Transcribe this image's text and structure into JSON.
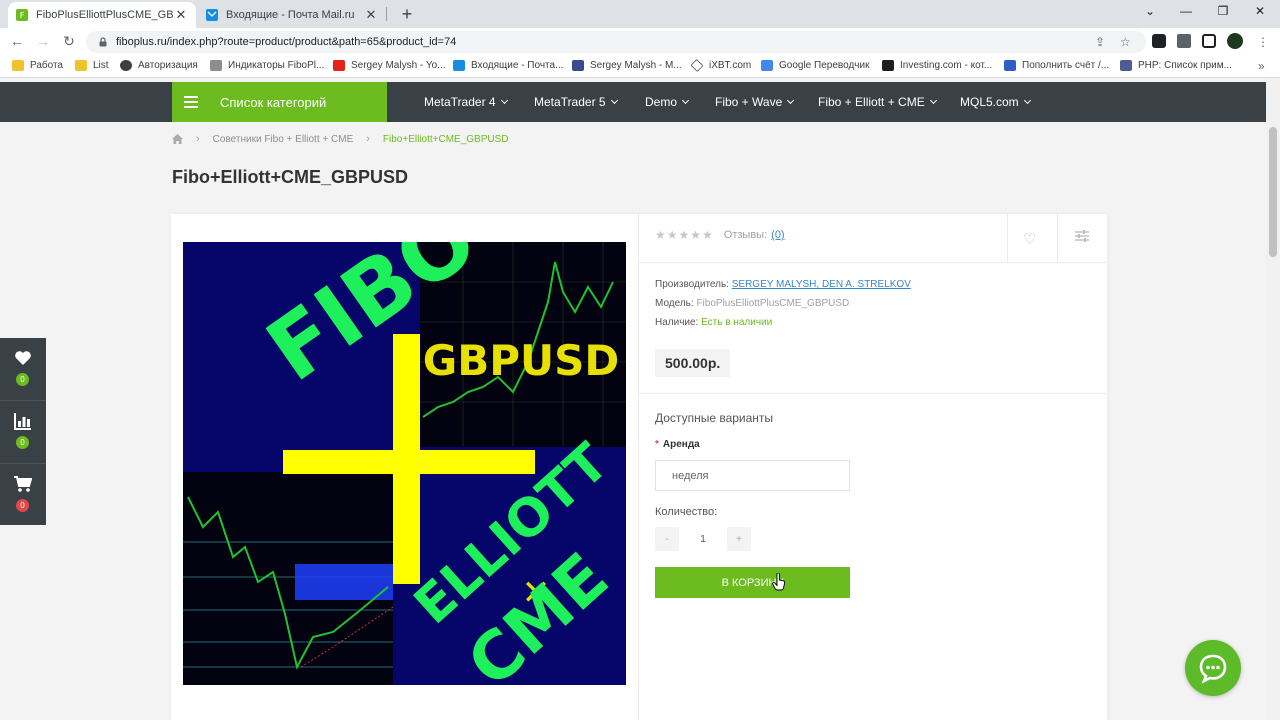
{
  "browser": {
    "tabs": [
      {
        "title": "FiboPlusElliottPlusCME_GBPUSD",
        "active": true
      },
      {
        "title": "Входящие - Почта Mail.ru",
        "active": false
      }
    ],
    "url": "fiboplus.ru/index.php?route=product/product&path=65&product_id=74",
    "bookmarks": [
      "Работа",
      "List",
      "Авторизация",
      "Индикаторы FiboPl...",
      "Sergey Malysh - Yo...",
      "Входящие - Почта...",
      "Sergey Malysh - M...",
      "iXBT.com",
      "Google Переводчик",
      "Investing.com - кот...",
      "Пополнить счёт /...",
      "PHP: Список прим..."
    ]
  },
  "site": {
    "nav": {
      "categories_label": "Список категорий",
      "items": [
        "MetaTrader 4",
        "MetaTrader 5",
        "Demo",
        "Fibo + Wave",
        "Fibo + Elliott + CME",
        "MQL5.com"
      ]
    },
    "breadcrumb": [
      "Советники Fibo + Elliott + CME",
      "Fibo+Elliott+CME_GBPUSD"
    ],
    "product": {
      "title": "Fibo+Elliott+CME_GBPUSD",
      "image_text": {
        "fibo": "FIBO",
        "pair": "GBPUSD",
        "elliott": "ELLIOTT",
        "cme": "CME"
      },
      "reviews_label": "Отзывы:",
      "reviews_count": "(0)",
      "rating": 0,
      "manufacturer_label": "Производитель:",
      "manufacturer": "SERGEY MALYSH, DEN A. STRELKOV",
      "model_label": "Модель:",
      "model": "FiboPlusElliottPlusCME_GBPUSD",
      "availability_label": "Наличие:",
      "availability": "Есть в наличии",
      "price": "500.00р.",
      "options_title": "Доступные варианты",
      "rent_label": "Аренда",
      "rent_value": "неделя",
      "qty_label": "Количество:",
      "qty_minus": "-",
      "qty_value": "1",
      "qty_plus": "+",
      "buy_label": "В КОРЗИНУ"
    },
    "sidebar": {
      "wishlist_count": "0",
      "compare_count": "0",
      "cart_count": "0"
    },
    "colors": {
      "accent_green": "#6cbb1f",
      "nav_dark": "#3a4146",
      "badge_red": "#e04848"
    }
  }
}
